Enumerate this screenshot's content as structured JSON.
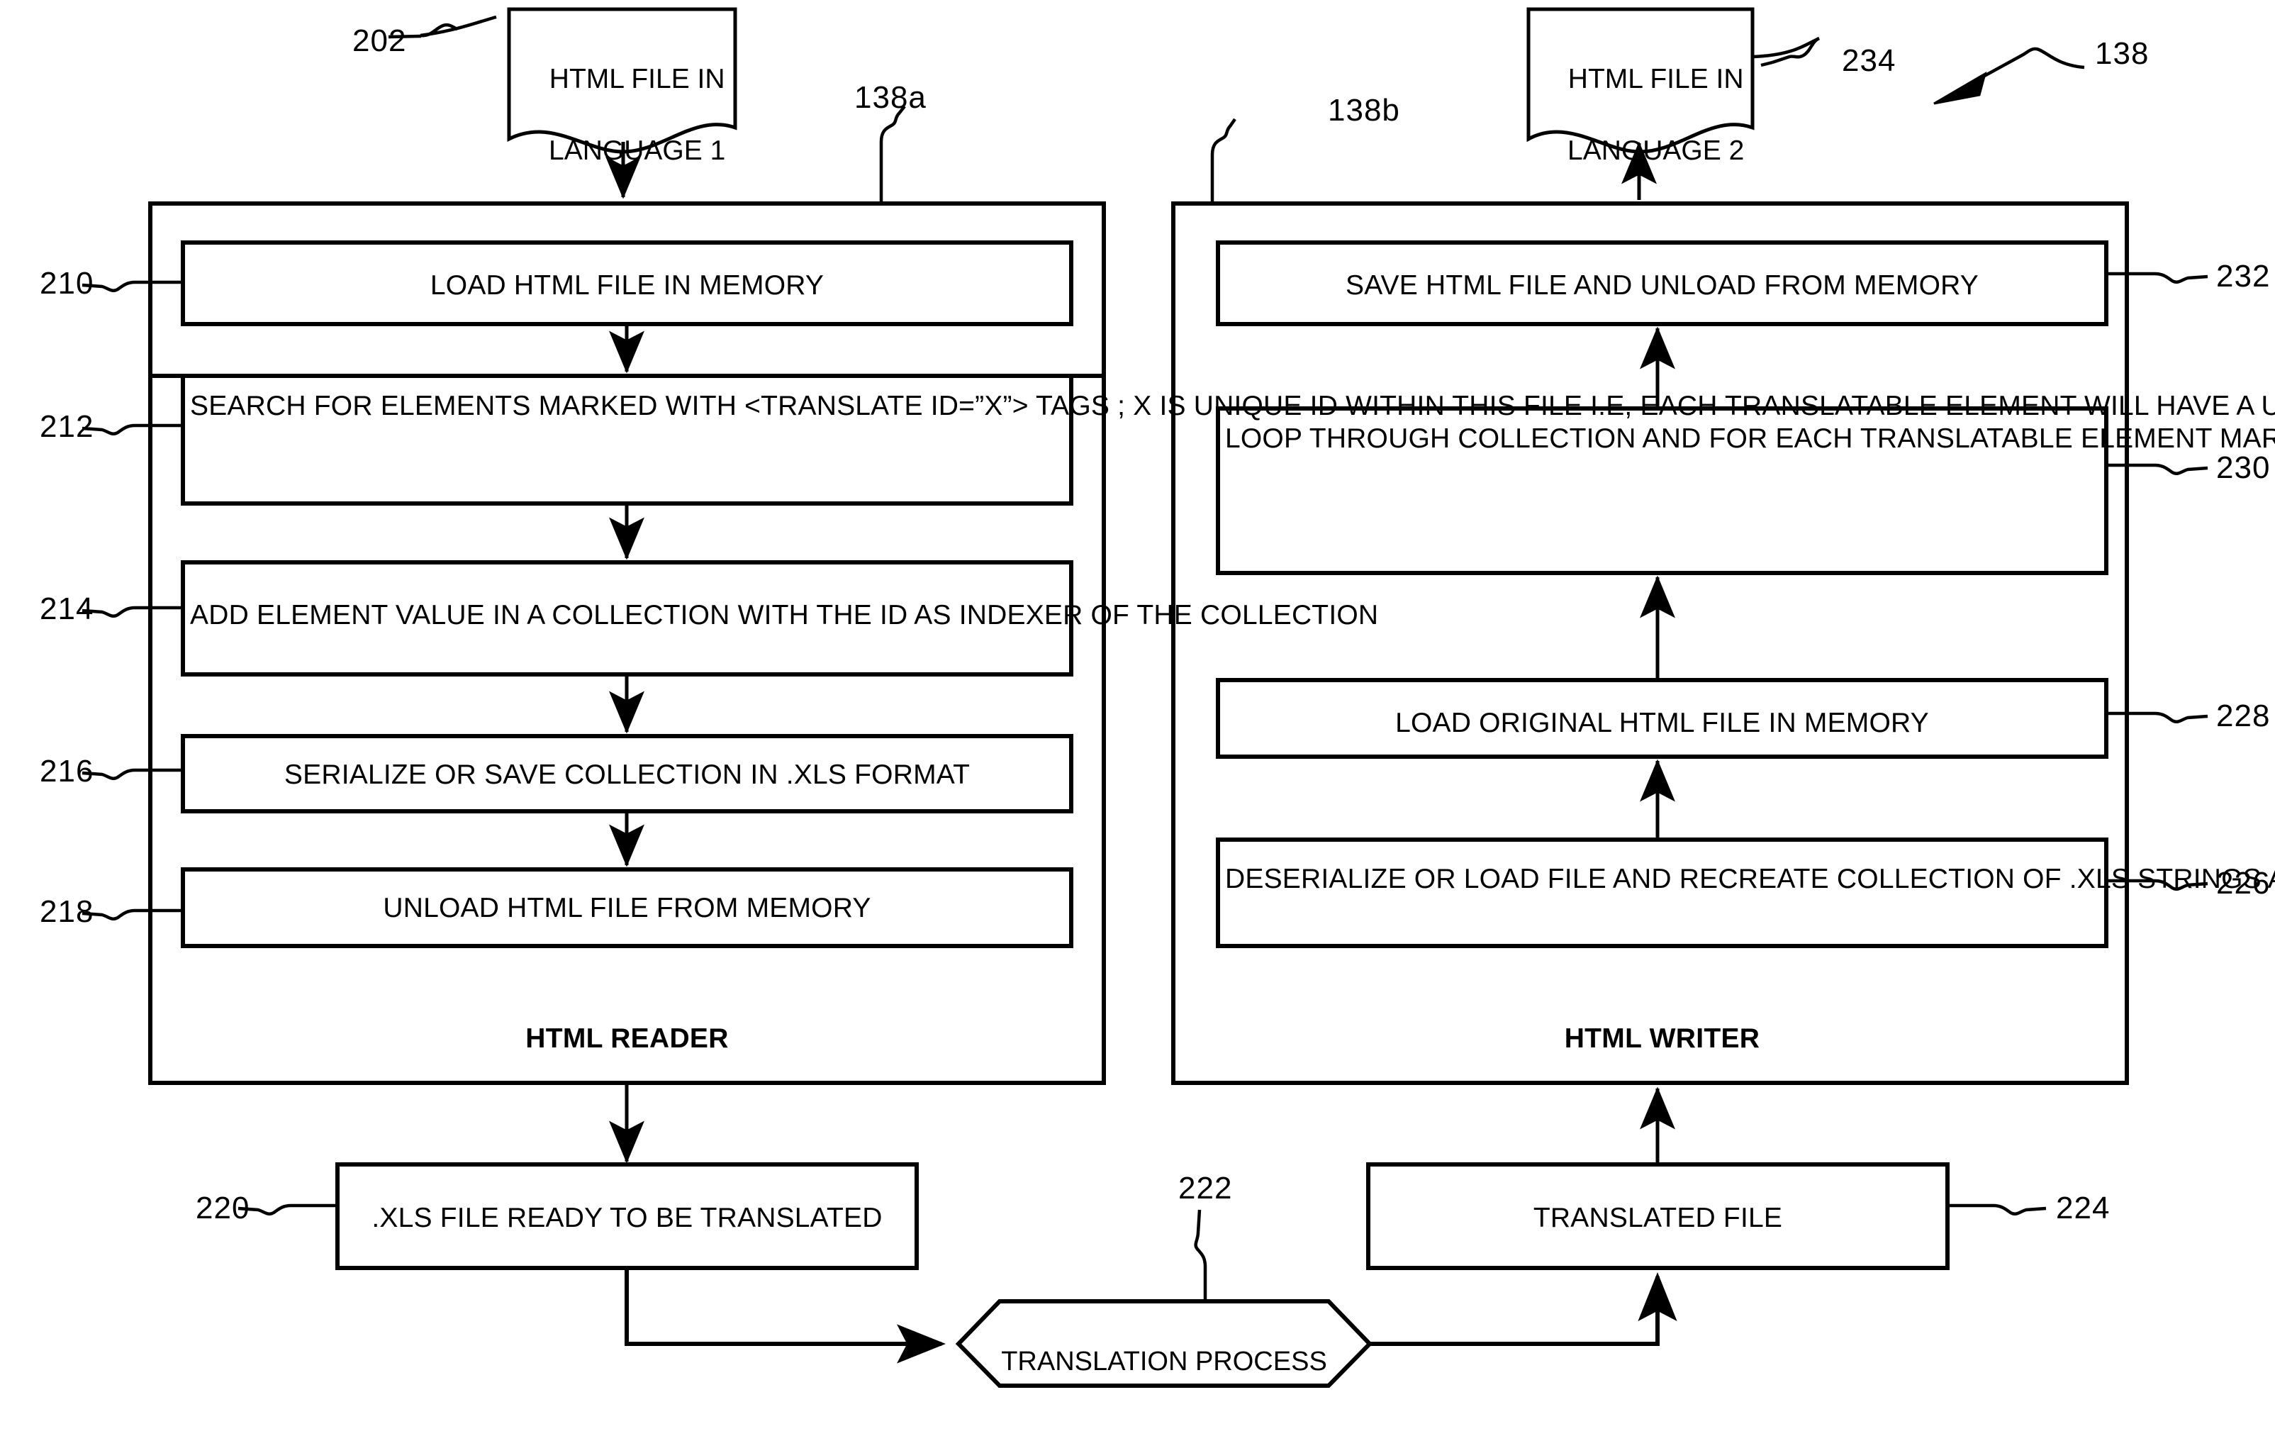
{
  "figure": {
    "overall_ref": "138",
    "reader_container_ref": "138a",
    "writer_container_ref": "138b",
    "reader_section_label": "HTML READER",
    "writer_section_label": "HTML WRITER"
  },
  "documents": {
    "input": {
      "ref": "202",
      "line1": "HTML FILE IN",
      "line2": "LANGUAGE 1"
    },
    "output": {
      "ref": "234",
      "line1": "HTML FILE IN",
      "line2": "LANGUAGE 2"
    }
  },
  "reader_steps": [
    {
      "ref": "210",
      "text": "LOAD HTML FILE IN MEMORY"
    },
    {
      "ref": "212",
      "text": "SEARCH FOR ELEMENTS MARKED WITH <TRANSLATE ID=”X”> TAGS ; X IS UNIQUE ID WITHIN THIS FILE I.E, EACH TRANSLATABLE ELEMENT WILL HAVE A UNIQUE ID"
    },
    {
      "ref": "214",
      "text": "ADD ELEMENT VALUE IN A COLLECTION WITH THE ID AS INDEXER OF THE COLLECTION"
    },
    {
      "ref": "216",
      "text": "SERIALIZE OR SAVE COLLECTION IN .XLS FORMAT"
    },
    {
      "ref": "218",
      "text": "UNLOAD HTML FILE FROM MEMORY"
    }
  ],
  "writer_steps": [
    {
      "ref": "232",
      "text": "SAVE HTML FILE AND UNLOAD FROM MEMORY"
    },
    {
      "ref": "230",
      "text": "LOOP THROUGH COLLECTION AND FOR EACH TRANSLATABLE ELEMENT MARKED WITH <TRANSLATE ID=”X”, REPLACE THE STRING WITH TRANSLATED STRING, USING THE UNIQUE ID"
    },
    {
      "ref": "228",
      "text": "LOAD ORIGINAL HTML FILE IN MEMORY"
    },
    {
      "ref": "226",
      "text": "DESERIALIZE OR LOAD FILE AND RECREATE COLLECTION OF .XLS STRINGS AND IDS"
    }
  ],
  "bottom": {
    "xls_file": {
      "ref": "220",
      "text": ".XLS FILE READY TO BE TRANSLATED"
    },
    "translation_process": {
      "ref": "222",
      "text": "TRANSLATION PROCESS"
    },
    "translated_file": {
      "ref": "224",
      "text": "TRANSLATED FILE"
    }
  },
  "colors": {
    "ink": "#000000",
    "paper": "#ffffff"
  }
}
